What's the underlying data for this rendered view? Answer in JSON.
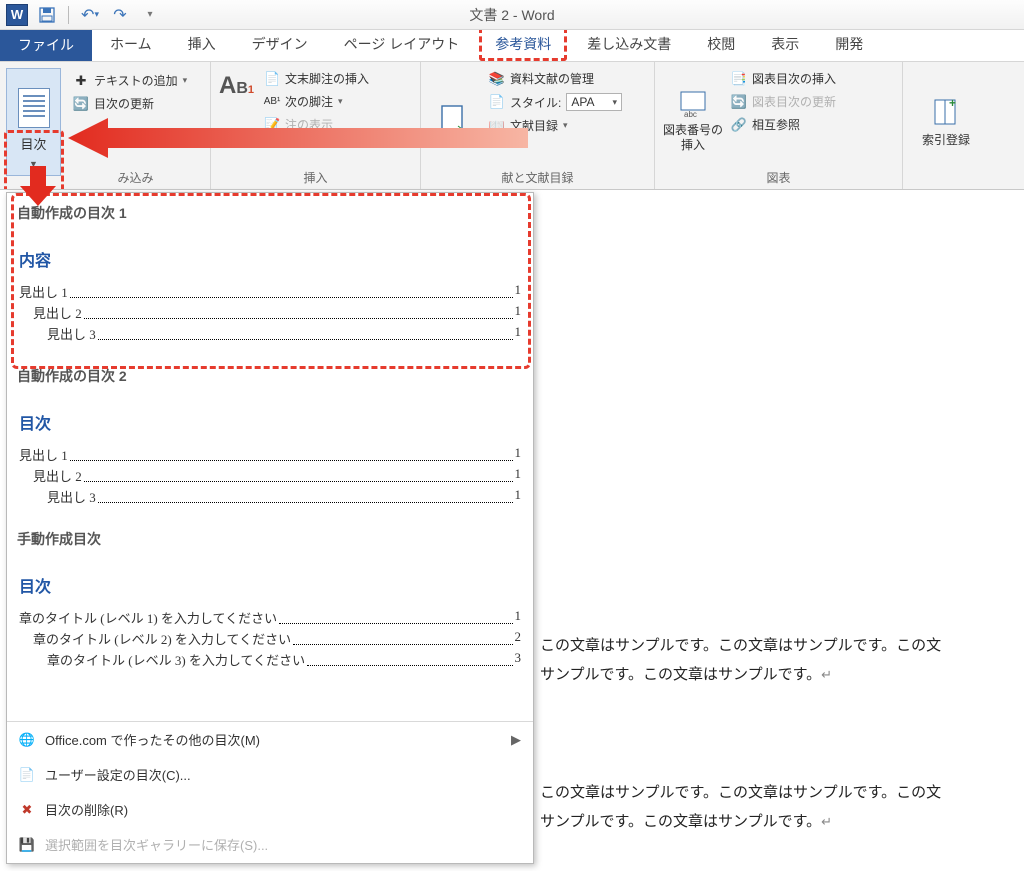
{
  "title": "文書 2 - Word",
  "qat": {
    "save_tip": "保存",
    "undo_tip": "元に戻す",
    "redo_tip": "やり直し"
  },
  "tabs": {
    "file": "ファイル",
    "home": "ホーム",
    "insert": "挿入",
    "design": "デザイン",
    "layout": "ページ レイアウト",
    "references": "参考資料",
    "mailmerge": "差し込み文書",
    "review": "校閲",
    "view": "表示",
    "developer": "開発"
  },
  "ribbon": {
    "toc": {
      "label": "目次"
    },
    "add_text": "テキストの追加",
    "update_toc": "目次の更新",
    "insert_endnote": "文末脚注の挿入",
    "next_footnote": "次の脚注",
    "manage_sources": "資料文献の管理",
    "style_label": "スタイル:",
    "style_value": "APA",
    "bibliography": "文献目録",
    "insert_caption": "図表番号の\n挿入",
    "insert_tof": "図表目次の挿入",
    "update_tof": "図表目次の更新",
    "cross_ref": "相互参照",
    "mark_index": "索引登録",
    "group_insert": "挿入",
    "group_bib": "献と文献目録",
    "group_captions": "図表",
    "group_mikomi": "み込み"
  },
  "toc_panel": {
    "auto1": {
      "category": "自動作成の目次 1",
      "title": "内容",
      "lines": [
        {
          "label": "見出し 1",
          "page": "1",
          "indent": 0
        },
        {
          "label": "見出し 2",
          "page": "1",
          "indent": 1
        },
        {
          "label": "見出し 3",
          "page": "1",
          "indent": 2
        }
      ]
    },
    "auto2": {
      "category": "自動作成の目次 2",
      "title": "目次",
      "lines": [
        {
          "label": "見出し 1",
          "page": "1",
          "indent": 0
        },
        {
          "label": "見出し 2",
          "page": "1",
          "indent": 1
        },
        {
          "label": "見出し 3",
          "page": "1",
          "indent": 2
        }
      ]
    },
    "manual": {
      "category": "手動作成目次",
      "title": "目次",
      "lines": [
        {
          "label": "章のタイトル (レベル 1) を入力してください",
          "page": "1",
          "indent": 0
        },
        {
          "label": "章のタイトル (レベル 2) を入力してください",
          "page": "2",
          "indent": 1
        },
        {
          "label": "章のタイトル (レベル 3) を入力してください",
          "page": "3",
          "indent": 2
        }
      ]
    },
    "menu": {
      "office": "Office.com で作ったその他の目次(M)",
      "custom": "ユーザー設定の目次(C)...",
      "remove": "目次の削除(R)",
      "save_gallery": "選択範囲を目次ギャラリーに保存(S)..."
    }
  },
  "document": {
    "para1a": "この文章はサンプルです。この文章はサンプルです。この文",
    "para1b": "サンプルです。この文章はサンプルです。",
    "para2a": "この文章はサンプルです。この文章はサンプルです。この文",
    "para2b": "サンプルです。この文章はサンプルです。"
  }
}
